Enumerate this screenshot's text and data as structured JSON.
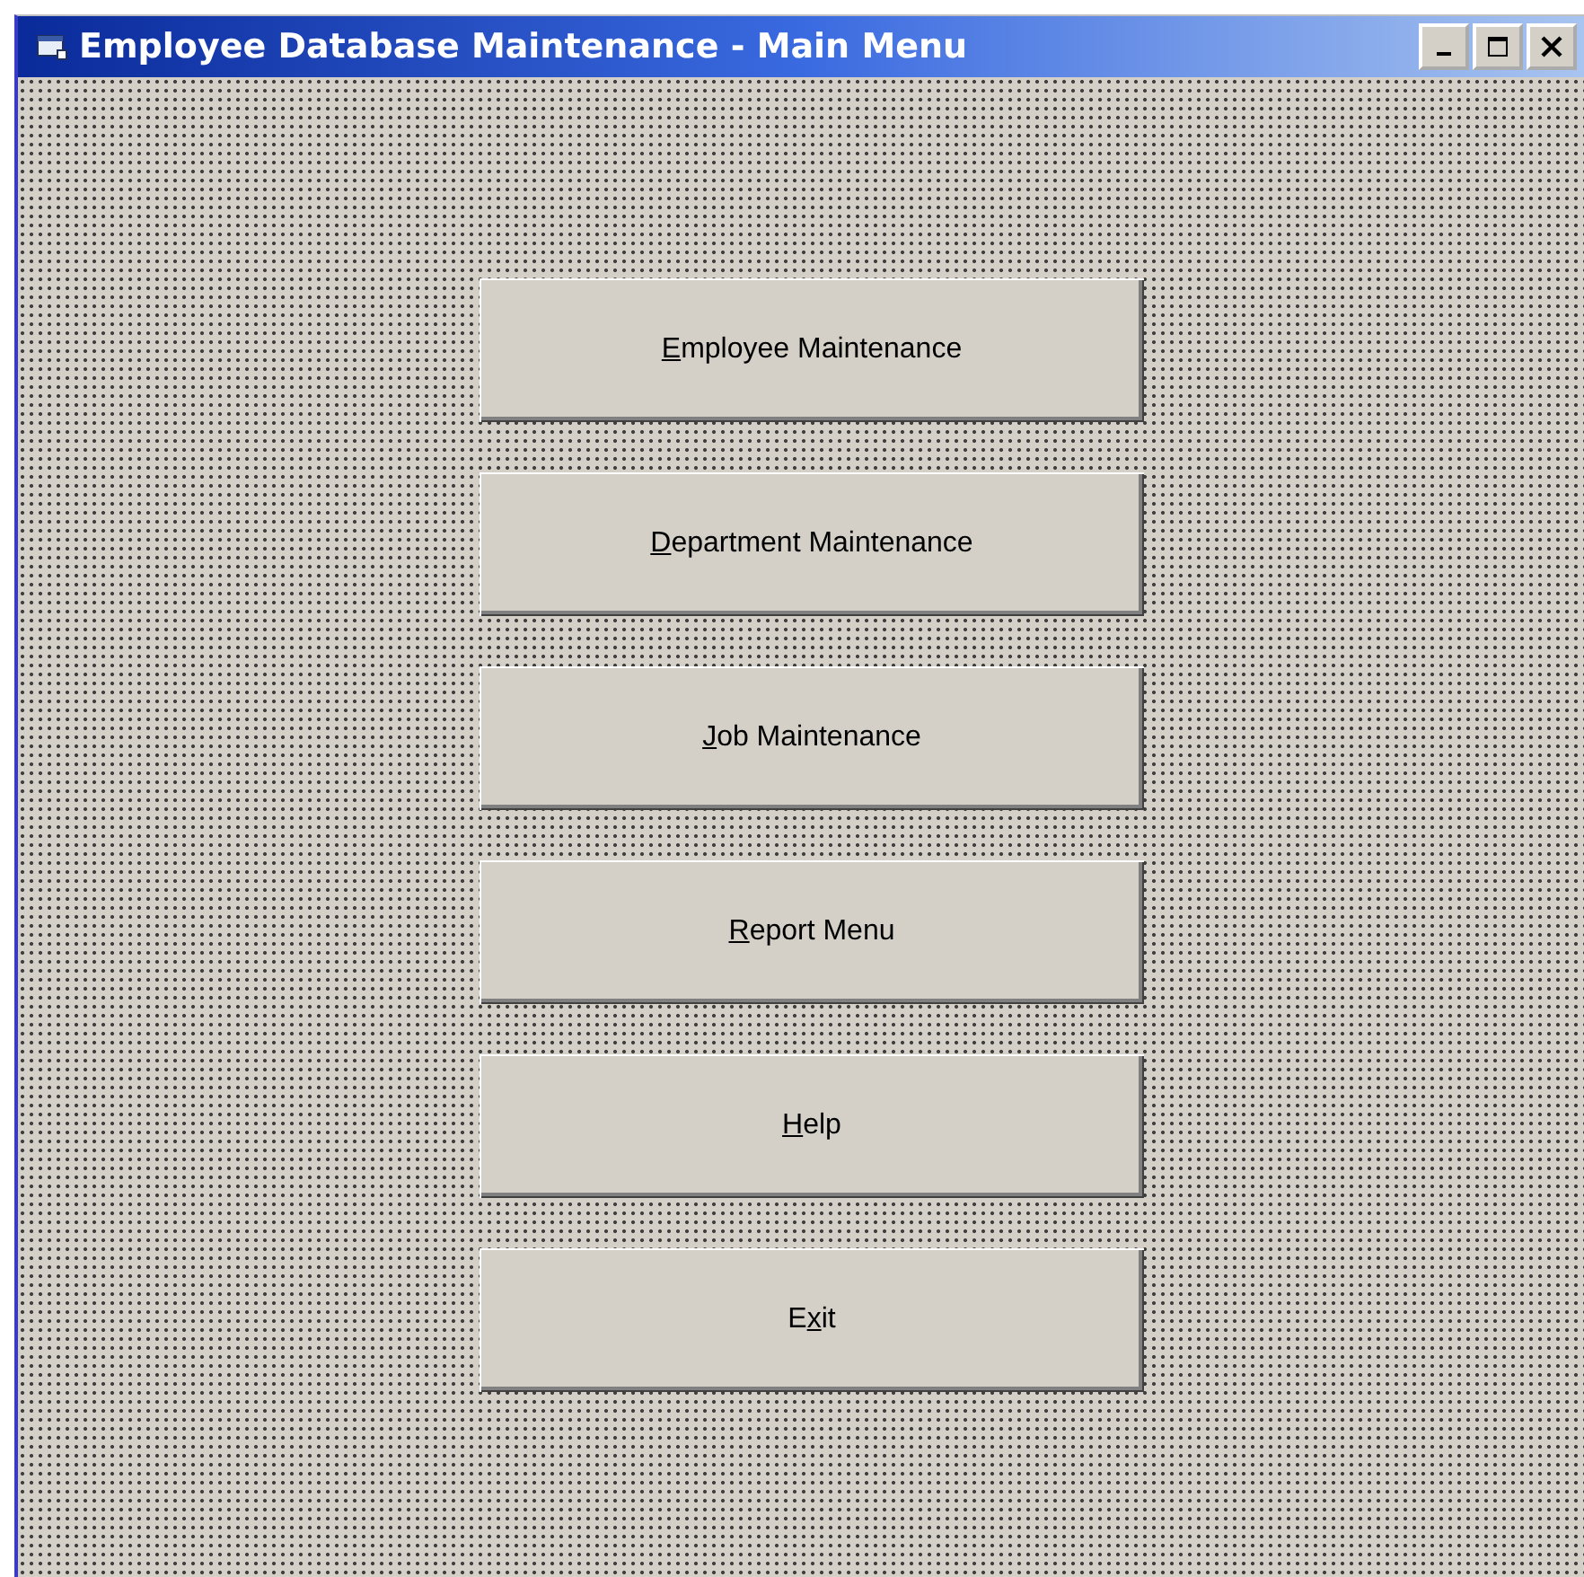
{
  "window": {
    "title": "Employee Database Maintenance - Main Menu"
  },
  "buttons": [
    {
      "access_key": "E",
      "label_after": "mployee Maintenance"
    },
    {
      "access_key": "D",
      "label_after": "epartment Maintenance"
    },
    {
      "access_key": "J",
      "label_after": "ob Maintenance"
    },
    {
      "access_key": "R",
      "label_after": "eport Menu"
    },
    {
      "access_key": "H",
      "label_after": "elp"
    },
    {
      "label_before": "E",
      "access_key": "x",
      "label_after": "it"
    }
  ]
}
